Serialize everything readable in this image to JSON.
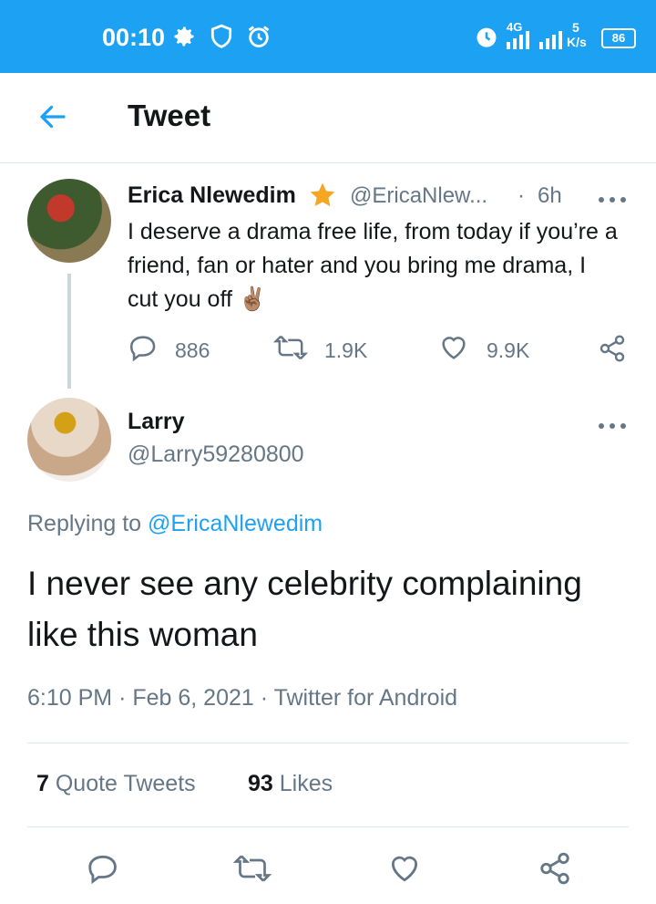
{
  "status_bar": {
    "time": "00:10",
    "network": "4G",
    "speed_value": "5",
    "speed_unit": "K/s",
    "battery": "86"
  },
  "header": {
    "title": "Tweet"
  },
  "parent_tweet": {
    "author_name": "Erica Nlewedim",
    "handle": "@EricaNlew...",
    "separator": "·",
    "time_ago": "6h",
    "text": "I deserve a drama free life, from today if you’re a friend, fan or hater and you bring me drama, I cut you off ✌🏽",
    "replies": "886",
    "retweets": "1.9K",
    "likes": "9.9K"
  },
  "main_tweet": {
    "author_name": "Larry",
    "handle": "@Larry59280800",
    "replying_prefix": "Replying to",
    "replying_to": "@EricaNlewedim",
    "text": "I never see any celebrity complaining like this woman",
    "time": "6:10 PM",
    "date": "Feb 6, 2021",
    "client": "Twitter for Android",
    "quote_count": "7",
    "quote_label": "Quote Tweets",
    "like_count": "93",
    "like_label": "Likes"
  },
  "colors": {
    "accent": "#1da1f2",
    "muted": "#657786"
  },
  "icons": [
    "settings-icon",
    "shield-icon",
    "alarm-icon",
    "back-arrow-icon",
    "star-icon",
    "more-icon",
    "reply-icon",
    "retweet-icon",
    "like-icon",
    "share-icon"
  ]
}
